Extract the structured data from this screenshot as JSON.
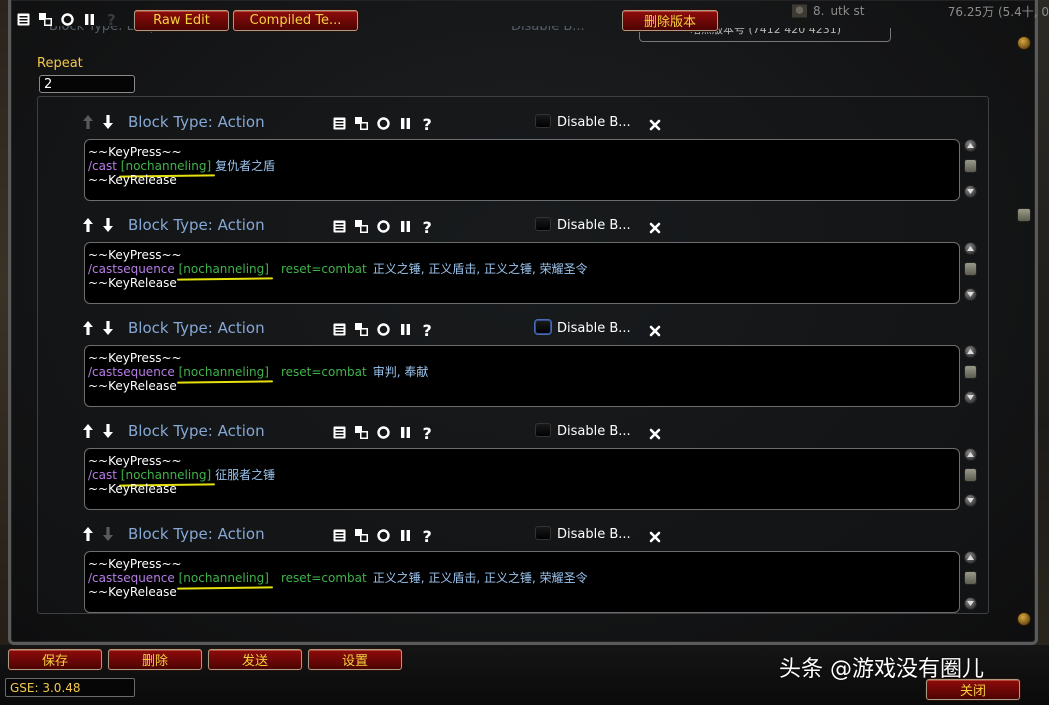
{
  "toolbar": {
    "raw_edit": "Raw Edit",
    "compiled": "Compiled Te...",
    "delete_version": "删除版本"
  },
  "top_right": {
    "label": "8.",
    "name": "utk st",
    "value": "76.25万",
    "extra": "(5.4十, 0"
  },
  "ghost": {
    "type": "Block Type: Loop",
    "disable": "Disable B...",
    "version": "暗黑版本号 (7412 420 4231)"
  },
  "repeat": {
    "label": "Repeat",
    "value": "2"
  },
  "labels": {
    "block_type": "Block Type: Action",
    "disable": "Disable B...",
    "keypress": "~~KeyPress~~",
    "keyrelease": "~~KeyRelease"
  },
  "blocks": [
    {
      "line2": {
        "cmd": "/cast",
        "cond": "[nochanneling]",
        "reset": "",
        "spells": "复仇者之盾"
      }
    },
    {
      "line2": {
        "cmd": "/castsequence",
        "cond": "[nochanneling]",
        "reset": "reset=combat",
        "spells": "正义之锤, 正义盾击, 正义之锤, 荣耀圣令"
      }
    },
    {
      "line2": {
        "cmd": "/castsequence",
        "cond": "[nochanneling]",
        "reset": "reset=combat",
        "spells": "审判, 奉献"
      }
    },
    {
      "line2": {
        "cmd": "/cast",
        "cond": "[nochanneling]",
        "reset": "",
        "spells": "征服者之锤"
      }
    },
    {
      "line2": {
        "cmd": "/castsequence",
        "cond": "[nochanneling]",
        "reset": "reset=combat",
        "spells": "正义之锤, 正义盾击, 正义之锤, 荣耀圣令"
      }
    }
  ],
  "bottom": {
    "save": "保存",
    "delete": "删除",
    "send": "发送",
    "settings": "设置",
    "close": "关闭",
    "version": "GSE: 3.0.48",
    "watermark": "头条 @游戏没有圈儿"
  },
  "colors": {
    "button_red": "#6b0706",
    "button_text": "#f4d23e",
    "block_type": "#86a8d4",
    "command": "#b77ee5",
    "condition": "#3fb34a",
    "spell": "#9ac4ee",
    "underline": "#e5e10f",
    "repeat_label": "#f2c94c"
  },
  "icons": [
    "list-icon",
    "copy-icon",
    "circle-icon",
    "pause-icon",
    "help-icon",
    "arrow-up-icon",
    "arrow-down-icon",
    "close-x-icon"
  ]
}
